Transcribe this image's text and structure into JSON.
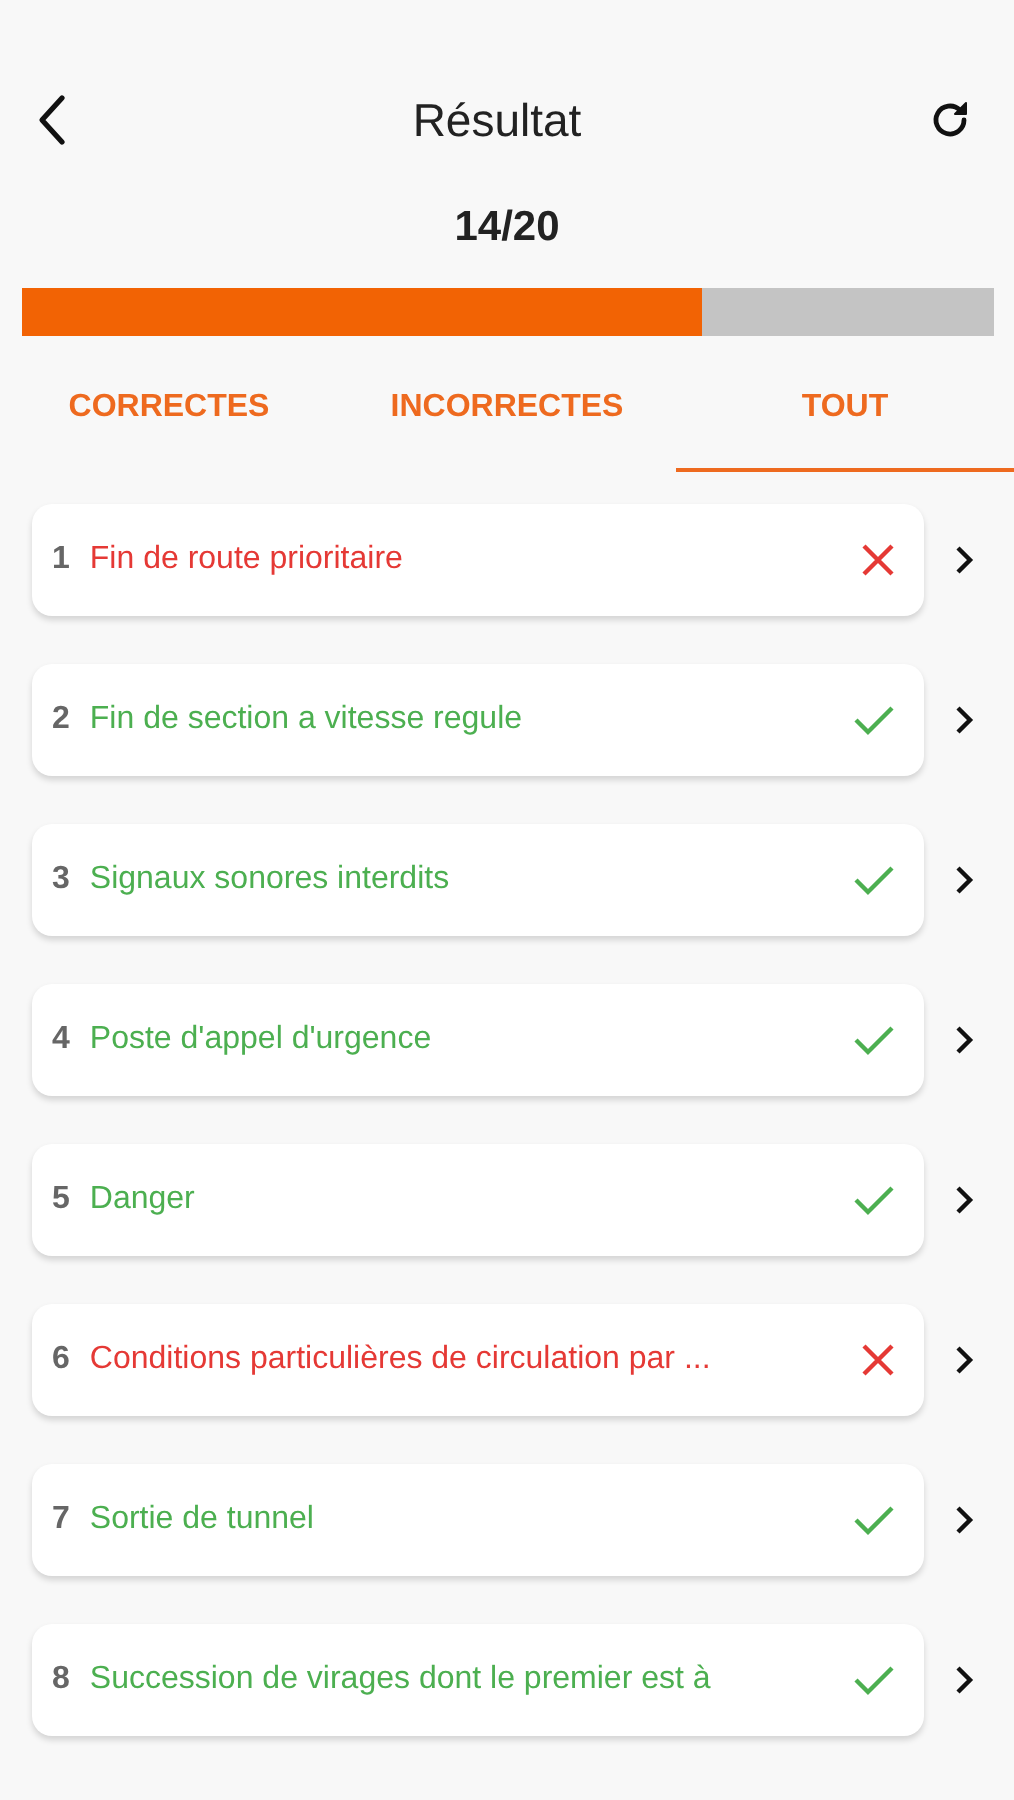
{
  "header": {
    "title": "Résultat"
  },
  "score": {
    "text": "14/20",
    "level": 0.7
  },
  "tabs": [
    {
      "label": "CORRECTES",
      "selected": false
    },
    {
      "label": "INCORRECTES",
      "selected": false
    },
    {
      "label": "TOUT",
      "selected": true
    }
  ],
  "results": [
    {
      "number": "1",
      "title": "Fin de route prioritaire",
      "correct": false
    },
    {
      "number": "2",
      "title": "Fin de section a vitesse regule",
      "correct": true
    },
    {
      "number": "3",
      "title": "Signaux sonores interdits",
      "correct": true
    },
    {
      "number": "4",
      "title": "Poste d'appel d'urgence",
      "correct": true
    },
    {
      "number": "5",
      "title": "Danger",
      "correct": true
    },
    {
      "number": "6",
      "title": "Conditions particulières de circulation par ...",
      "correct": false
    },
    {
      "number": "7",
      "title": "Sortie de tunnel",
      "correct": true
    },
    {
      "number": "8",
      "title": "Succession de virages dont le premier est à",
      "correct": true
    }
  ]
}
